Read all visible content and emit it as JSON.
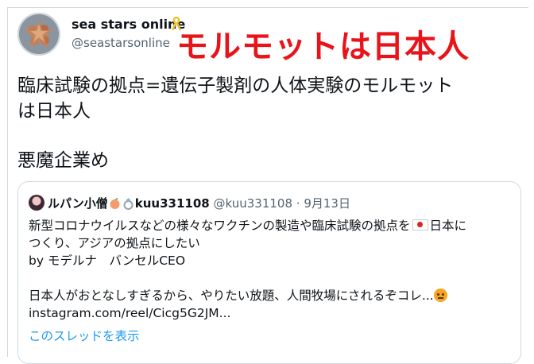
{
  "tweet": {
    "display_name": "sea stars online",
    "handle": "@seastarsonline",
    "overlay_caption": "モルモットは日本人",
    "body_line1": "臨床試験の拠点=遺伝子製剤の人体実験のモルモット",
    "body_line2": "は日本人",
    "body_line3": "悪魔企業め"
  },
  "quoted": {
    "display_name": "ルパン小僧",
    "username_bold": "kuu331108",
    "handle_date": "@kuu331108 · 9月13日",
    "line1a": "新型コロナウイルスなどの様々なワクチンの製造や臨床試験の拠点を",
    "line1b": "日本に",
    "line2": "つくり、アジアの拠点にしたい",
    "line3": "by モデルナ　バンセルCEO",
    "line4": "日本人がおとなしすぎるから、やりたい放題、人間牧場にされるぞコレ...",
    "link": "instagram.com/reel/Cicg5G2JM...",
    "show_thread": "このスレッドを表示"
  },
  "colors": {
    "overlay_red": "#e8141a",
    "link_blue": "#1d9bf0",
    "secondary_gray": "#536471"
  },
  "icons": [
    "yellow-ribbon-icon",
    "peach-icon",
    "ring-icon",
    "japan-flag-icon",
    "angry-face-icon"
  ]
}
